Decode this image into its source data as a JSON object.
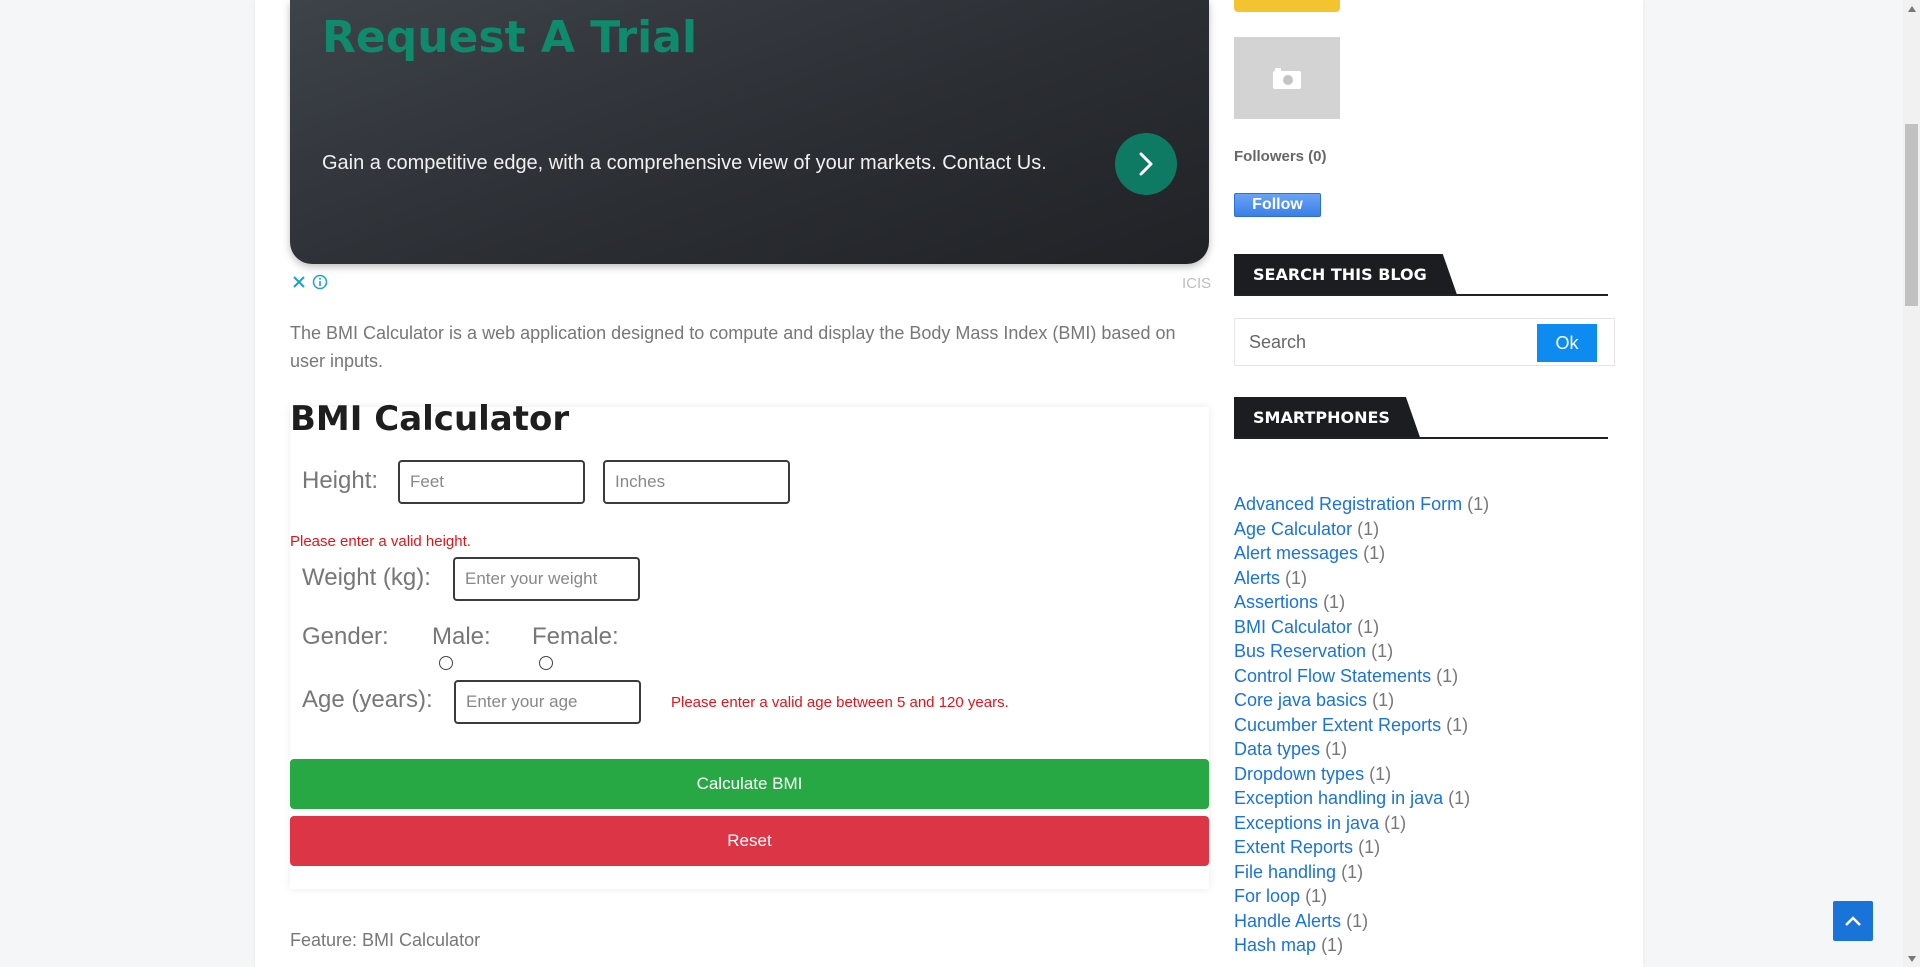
{
  "ad": {
    "title": "Request A Trial",
    "text": "Gain a competitive edge, with a comprehensive view of your markets. Contact Us.",
    "brand": "ICIS"
  },
  "intro": "The BMI Calculator is a web application designed to compute and display the Body Mass Index (BMI) based on user inputs.",
  "bmi": {
    "title": "BMI Calculator",
    "height_label": "Height:",
    "feet_placeholder": "Feet",
    "inches_placeholder": "Inches",
    "height_error": "Please enter a valid height.",
    "weight_label": "Weight (kg):",
    "weight_placeholder": "Enter your weight",
    "gender_label": "Gender:",
    "male_label": "Male:",
    "female_label": "Female:",
    "age_label": "Age (years):",
    "age_placeholder": "Enter your age",
    "age_error": "Please enter a valid age between 5 and 120 years.",
    "calculate_label": "Calculate BMI",
    "reset_label": "Reset"
  },
  "feature": "Feature: BMI Calculator",
  "sidebar": {
    "followers": "Followers (0)",
    "follow_label": "Follow",
    "search_heading": "SEARCH THIS BLOG",
    "search_placeholder": "Search",
    "search_button": "Ok",
    "smartphones_heading": "SMARTPHONES",
    "labels": [
      {
        "name": "Advanced Registration Form",
        "count": "(1)"
      },
      {
        "name": "Age Calculator",
        "count": "(1)"
      },
      {
        "name": "Alert messages",
        "count": "(1)"
      },
      {
        "name": "Alerts",
        "count": "(1)"
      },
      {
        "name": "Assertions",
        "count": "(1)"
      },
      {
        "name": "BMI Calculator",
        "count": "(1)"
      },
      {
        "name": "Bus Reservation",
        "count": "(1)"
      },
      {
        "name": "Control Flow Statements",
        "count": "(1)"
      },
      {
        "name": "Core java basics",
        "count": "(1)"
      },
      {
        "name": "Cucumber Extent Reports",
        "count": "(1)"
      },
      {
        "name": "Data types",
        "count": "(1)"
      },
      {
        "name": "Dropdown types",
        "count": "(1)"
      },
      {
        "name": "Exception handling in java",
        "count": "(1)"
      },
      {
        "name": "Exceptions in java",
        "count": "(1)"
      },
      {
        "name": "Extent Reports",
        "count": "(1)"
      },
      {
        "name": "File handling",
        "count": "(1)"
      },
      {
        "name": "For loop",
        "count": "(1)"
      },
      {
        "name": "Handle Alerts",
        "count": "(1)"
      },
      {
        "name": "Hash map",
        "count": "(1)"
      }
    ]
  },
  "colors": {
    "accent_green": "#28a745",
    "accent_red": "#dc3545",
    "link_blue": "#1a73d9",
    "error_red": "#e0151c",
    "ad_title_teal": "#0f8a6c"
  }
}
